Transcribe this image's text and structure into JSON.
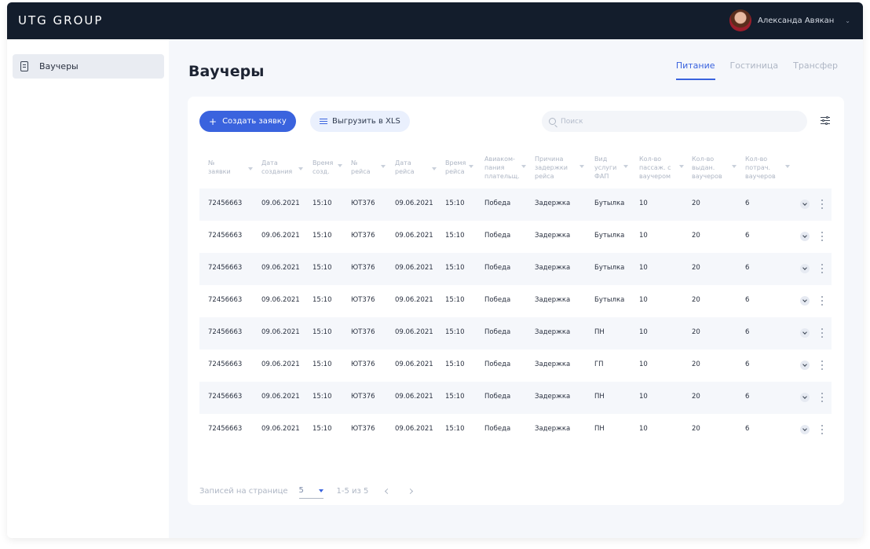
{
  "app": {
    "logo": "UTG GROUP"
  },
  "user": {
    "name": "Александа Авякан"
  },
  "sidebar": {
    "items": [
      {
        "label": "Ваучеры",
        "icon": "document-icon"
      }
    ]
  },
  "page": {
    "title": "Ваучеры"
  },
  "tabs": [
    {
      "label": "Питание",
      "active": true
    },
    {
      "label": "Гостиница",
      "active": false
    },
    {
      "label": "Трансфер",
      "active": false
    }
  ],
  "toolbar": {
    "create_label": "Создать заявку",
    "export_label": "Выгрузить в XLS",
    "search_placeholder": "Поиск"
  },
  "table": {
    "columns": [
      {
        "line1": "№",
        "line2": "заявки",
        "line3": ""
      },
      {
        "line1": "Дата",
        "line2": "создания",
        "line3": ""
      },
      {
        "line1": "Время",
        "line2": "созд.",
        "line3": ""
      },
      {
        "line1": "№",
        "line2": "рейса",
        "line3": ""
      },
      {
        "line1": "Дата",
        "line2": "рейса",
        "line3": ""
      },
      {
        "line1": "Время",
        "line2": "рейса",
        "line3": ""
      },
      {
        "line1": "Авиаком-",
        "line2": "пания",
        "line3": "плательщ."
      },
      {
        "line1": "Причина",
        "line2": "задержки",
        "line3": "рейса"
      },
      {
        "line1": "Вид",
        "line2": "услуги",
        "line3": "ФАП"
      },
      {
        "line1": "Кол-во",
        "line2": "пассаж. с",
        "line3": "ваучером"
      },
      {
        "line1": "Кол-во",
        "line2": "выдан.",
        "line3": "ваучеров"
      },
      {
        "line1": "Кол-во",
        "line2": "потрач.",
        "line3": "ваучеров"
      }
    ],
    "rows": [
      [
        "72456663",
        "09.06.2021",
        "15:10",
        "ЮТ376",
        "09.06.2021",
        "15:10",
        "Победа",
        "Задержка",
        "Бутылка",
        "10",
        "20",
        "6"
      ],
      [
        "72456663",
        "09.06.2021",
        "15:10",
        "ЮТ376",
        "09.06.2021",
        "15:10",
        "Победа",
        "Задержка",
        "Бутылка",
        "10",
        "20",
        "6"
      ],
      [
        "72456663",
        "09.06.2021",
        "15:10",
        "ЮТ376",
        "09.06.2021",
        "15:10",
        "Победа",
        "Задержка",
        "Бутылка",
        "10",
        "20",
        "6"
      ],
      [
        "72456663",
        "09.06.2021",
        "15:10",
        "ЮТ376",
        "09.06.2021",
        "15:10",
        "Победа",
        "Задержка",
        "Бутылка",
        "10",
        "20",
        "6"
      ],
      [
        "72456663",
        "09.06.2021",
        "15:10",
        "ЮТ376",
        "09.06.2021",
        "15:10",
        "Победа",
        "Задержка",
        "ПН",
        "10",
        "20",
        "6"
      ],
      [
        "72456663",
        "09.06.2021",
        "15:10",
        "ЮТ376",
        "09.06.2021",
        "15:10",
        "Победа",
        "Задержка",
        "ГП",
        "10",
        "20",
        "6"
      ],
      [
        "72456663",
        "09.06.2021",
        "15:10",
        "ЮТ376",
        "09.06.2021",
        "15:10",
        "Победа",
        "Задержка",
        "ПН",
        "10",
        "20",
        "6"
      ],
      [
        "72456663",
        "09.06.2021",
        "15:10",
        "ЮТ376",
        "09.06.2021",
        "15:10",
        "Победа",
        "Задержка",
        "ПН",
        "10",
        "20",
        "6"
      ]
    ]
  },
  "pagination": {
    "label": "Записей на странице",
    "page_size": "5",
    "range": "1-5 из 5"
  },
  "colors": {
    "topbar": "#131d2c",
    "accent": "#3a63de",
    "background": "#f5f7fb"
  }
}
